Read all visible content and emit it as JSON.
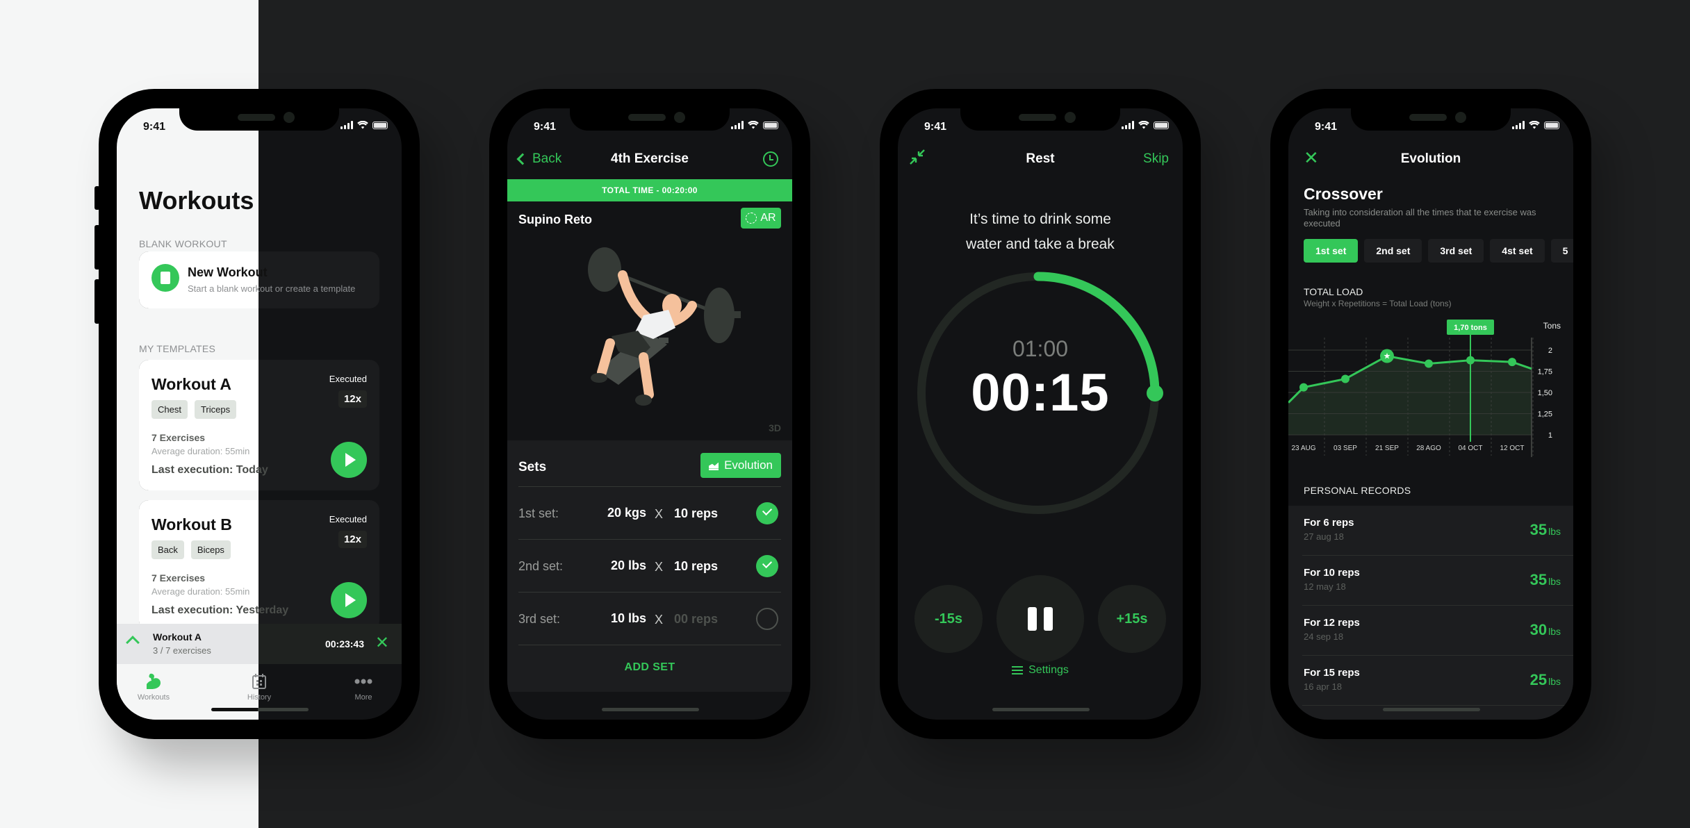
{
  "status_time": "9:41",
  "colors": {
    "accent": "#34c759",
    "dark_bg": "#121315",
    "light_bg": "#f5f6f6",
    "card_dark": "#1b1c1e"
  },
  "workouts_screen": {
    "title": "Workouts",
    "blank_section_label": "BLANK WORKOUT",
    "new_workout": {
      "title": "New Workout",
      "subtitle": "Start a blank workout or create a template",
      "icon": "new-document-icon"
    },
    "templates_section_label": "MY TEMPLATES",
    "templates": [
      {
        "name": "Workout A",
        "tags": [
          "Chest",
          "Triceps"
        ],
        "exercises": "7 Exercises",
        "avg_duration": "Average duration: 55min",
        "last_execution": "Last execution: Today",
        "executed_label": "Executed",
        "executed_count": "12x"
      },
      {
        "name": "Workout B",
        "tags": [
          "Back",
          "Biceps"
        ],
        "exercises": "7 Exercises",
        "avg_duration": "Average duration: 55min",
        "last_execution": "Last execution: Yesterday",
        "executed_label": "Executed",
        "executed_count": "12x"
      }
    ],
    "mini_player": {
      "title": "Workout A",
      "progress": "3 / 7 exercises",
      "elapsed": "00:23:43"
    },
    "tabbar": [
      {
        "label": "Workouts",
        "icon": "biceps-icon",
        "active": true
      },
      {
        "label": "History",
        "icon": "calendar-icon",
        "active": false
      },
      {
        "label": "More",
        "icon": "more-dots-icon",
        "active": false
      }
    ]
  },
  "exercise_screen": {
    "back_label": "Back",
    "title": "4th Exercise",
    "total_time": "TOTAL TIME - 00:20:00",
    "exercise_name": "Supino Reto",
    "ar_label": "AR",
    "badge_3d": "3D",
    "sets_title": "Sets",
    "evolution_label": "Evolution",
    "sets": [
      {
        "label": "1st set:",
        "weight": "20 kgs",
        "x": "X",
        "reps": "10 reps",
        "done": true
      },
      {
        "label": "2nd set:",
        "weight": "20 lbs",
        "x": "X",
        "reps": "10 reps",
        "done": true
      },
      {
        "label": "3rd set:",
        "weight": "10 lbs",
        "x": "X",
        "reps": "00 reps",
        "done": false
      }
    ],
    "add_set_label": "ADD SET"
  },
  "rest_screen": {
    "title": "Rest",
    "skip_label": "Skip",
    "message_line1": "It’s time to drink some",
    "message_line2": "water and take a break",
    "total": "01:00",
    "remaining": "00:15",
    "progress_fraction": 0.25,
    "minus_label": "-15s",
    "plus_label": "+15s",
    "settings_label": "Settings"
  },
  "evolution_screen": {
    "title": "Evolution",
    "exercise": "Crossover",
    "description": "Taking into consideration all the times that te exercise was executed",
    "set_tabs": [
      "1st set",
      "2nd set",
      "3rd set",
      "4st set",
      "5"
    ],
    "active_set_tab": 0,
    "total_load_title": "TOTAL LOAD",
    "total_load_sub": "Weight x Repetitions = Total Load (tons)",
    "personal_records_title": "PERSONAL RECORDS",
    "records": [
      {
        "title": "For 6 reps",
        "date": "27 aug 18",
        "value": "35",
        "unit": "lbs"
      },
      {
        "title": "For 10 reps",
        "date": "12 may 18",
        "value": "35",
        "unit": "lbs"
      },
      {
        "title": "For 12 reps",
        "date": "24 sep 18",
        "value": "30",
        "unit": "lbs"
      },
      {
        "title": "For 15 reps",
        "date": "16 apr 18",
        "value": "25",
        "unit": "lbs"
      }
    ]
  },
  "chart_data": {
    "type": "area",
    "title": "TOTAL LOAD",
    "subtitle": "Weight x Repetitions = Total Load (tons)",
    "ylabel": "Tons",
    "categories": [
      "23 AUG",
      "03 SEP",
      "21 SEP",
      "28 AGO",
      "04 OCT",
      "12 OCT"
    ],
    "values": [
      1.56,
      1.66,
      1.93,
      1.84,
      1.88,
      1.86
    ],
    "edge_start": 1.38,
    "edge_end": 1.78,
    "yticks": [
      "2",
      "1,75",
      "1,50",
      "1,25",
      "1"
    ],
    "ylim": [
      1,
      2
    ],
    "highlight_index": 2,
    "tooltip": {
      "index": 4,
      "label": "1,70 tons"
    },
    "grid": true,
    "axis_position": "right"
  }
}
